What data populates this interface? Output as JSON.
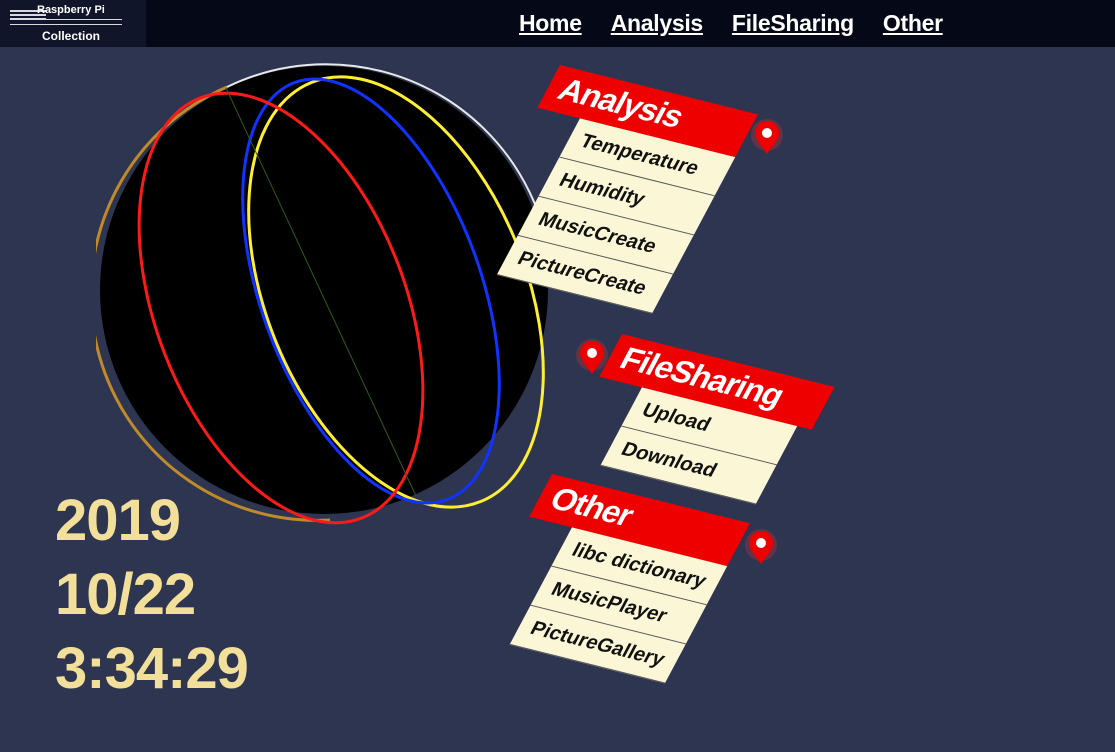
{
  "logo": {
    "top_text": "Raspberry Pi",
    "bottom_text": "Collection"
  },
  "nav": [
    "Home",
    "Analysis",
    "FileSharing",
    "Other"
  ],
  "clock": {
    "year": "2019",
    "date": "10/22",
    "time": "3:34:29"
  },
  "menus": {
    "analysis": {
      "title": "Analysis",
      "items": [
        "Temperature",
        "Humidity",
        "MusicCreate",
        "PictureCreate"
      ]
    },
    "filesharing": {
      "title": "FileSharing",
      "items": [
        "Upload",
        "Download"
      ]
    },
    "other": {
      "title": "Other",
      "items": [
        "libc dictionary",
        "MusicPlayer",
        "PictureGallery"
      ]
    }
  },
  "colors": {
    "background": "#2d3550",
    "topbar": "#050816",
    "accent_red": "#ee0000",
    "item_bg": "#fbf7d6",
    "clock_text": "#f2df99",
    "globe_orbit_yellow": "#ffee33",
    "globe_orbit_blue": "#1133ff",
    "globe_orbit_red": "#ff1a1a",
    "globe_rim_gold": "#c08a2a"
  },
  "icons": [
    "map-pin-icon"
  ]
}
